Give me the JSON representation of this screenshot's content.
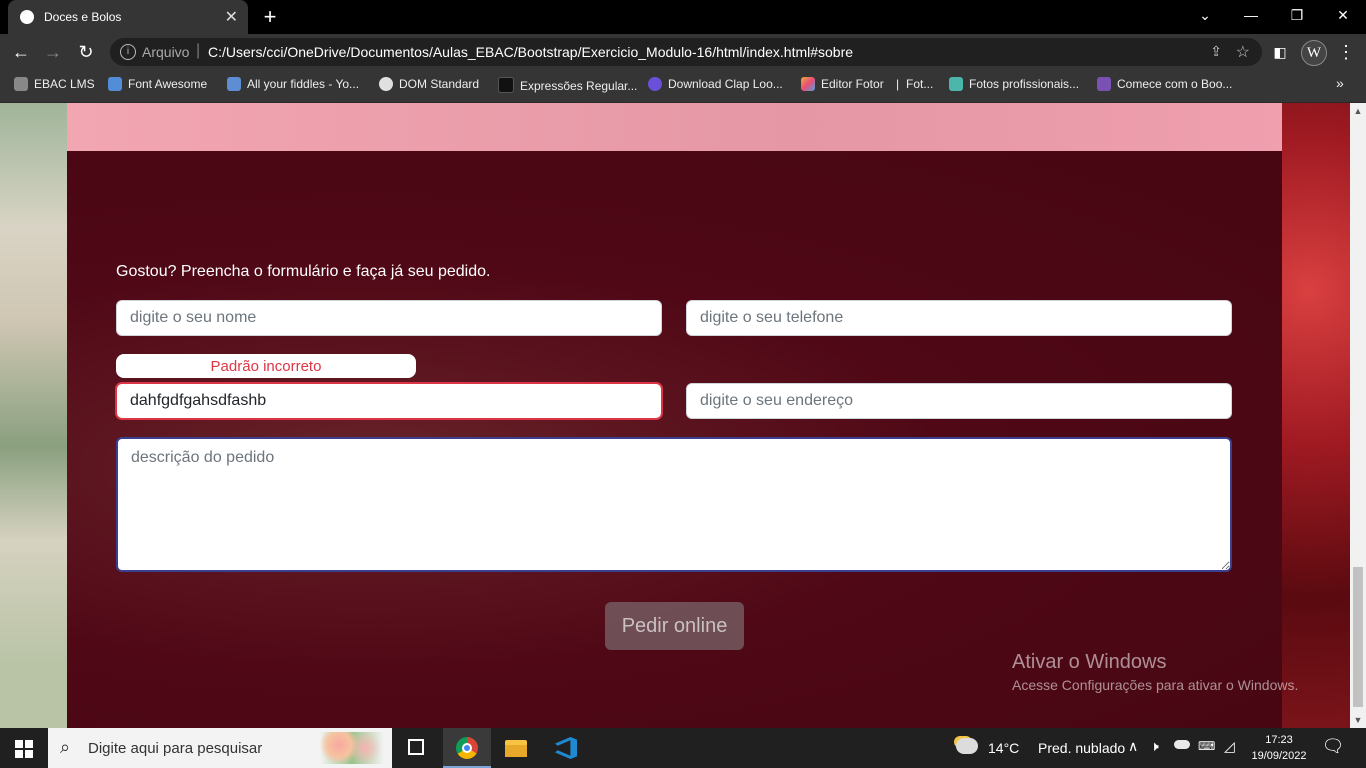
{
  "browser": {
    "tab_title": "Doces e Bolos",
    "new_tab_label": "+",
    "omnibox": {
      "scheme_label": "Arquivo",
      "url": "C:/Users/cci/OneDrive/Documentos/Aulas_EBAC/Bootstrap/Exercicio_Modulo-16/html/index.html#sobre"
    },
    "profile_initial": "W",
    "bookmarks": [
      {
        "label": "EBAC LMS",
        "icon": "ebac-icon",
        "color": "#888888"
      },
      {
        "label": "Font Awesome",
        "icon": "font-awesome-icon",
        "color": "#538dd7"
      },
      {
        "label": "All your fiddles - Yo...",
        "icon": "cloud-icon",
        "color": "#5f8dd3"
      },
      {
        "label": "DOM Standard",
        "icon": "whatwg-icon",
        "color": "#e0e0e0"
      },
      {
        "label": "Expressões Regular...",
        "icon": "m-icon",
        "color": "#111111"
      },
      {
        "label": "Download Clap Loo...",
        "icon": "audio-icon",
        "color": "#6b4fd8"
      },
      {
        "label": "Editor Fotor",
        "icon": "fotor-icon",
        "color": "#f2a93b"
      },
      {
        "label": "Fot...",
        "icon": "",
        "color": ""
      },
      {
        "label": "Fotos profissionais...",
        "icon": "d-icon",
        "color": "#4db6ac"
      },
      {
        "label": "Comece com o Boo...",
        "icon": "bootstrap-icon",
        "color": "#7952b3"
      }
    ]
  },
  "page": {
    "intro_text": "Gostou? Preencha o formulário e faça já seu pedido.",
    "form": {
      "name_placeholder": "digite o seu nome",
      "phone_placeholder": "digite o seu telefone",
      "email_value": "dahfgdfgahsdfashb",
      "email_error": "Padrão incorreto",
      "address_placeholder": "digite o seu endereço",
      "description_placeholder": "descrição do pedido",
      "submit_label": "Pedir online"
    },
    "watermark": {
      "title": "Ativar o Windows",
      "subtitle": "Acesse Configurações para ativar o Windows."
    }
  },
  "taskbar": {
    "search_placeholder": "Digite aqui para pesquisar",
    "weather_temp": "14°C",
    "weather_desc": "Pred. nublado",
    "time": "17:23",
    "date": "19/09/2022"
  },
  "colors": {
    "error": "#dc3545",
    "content_bg": "#4a0712",
    "pink_band": "#ef9fae"
  }
}
